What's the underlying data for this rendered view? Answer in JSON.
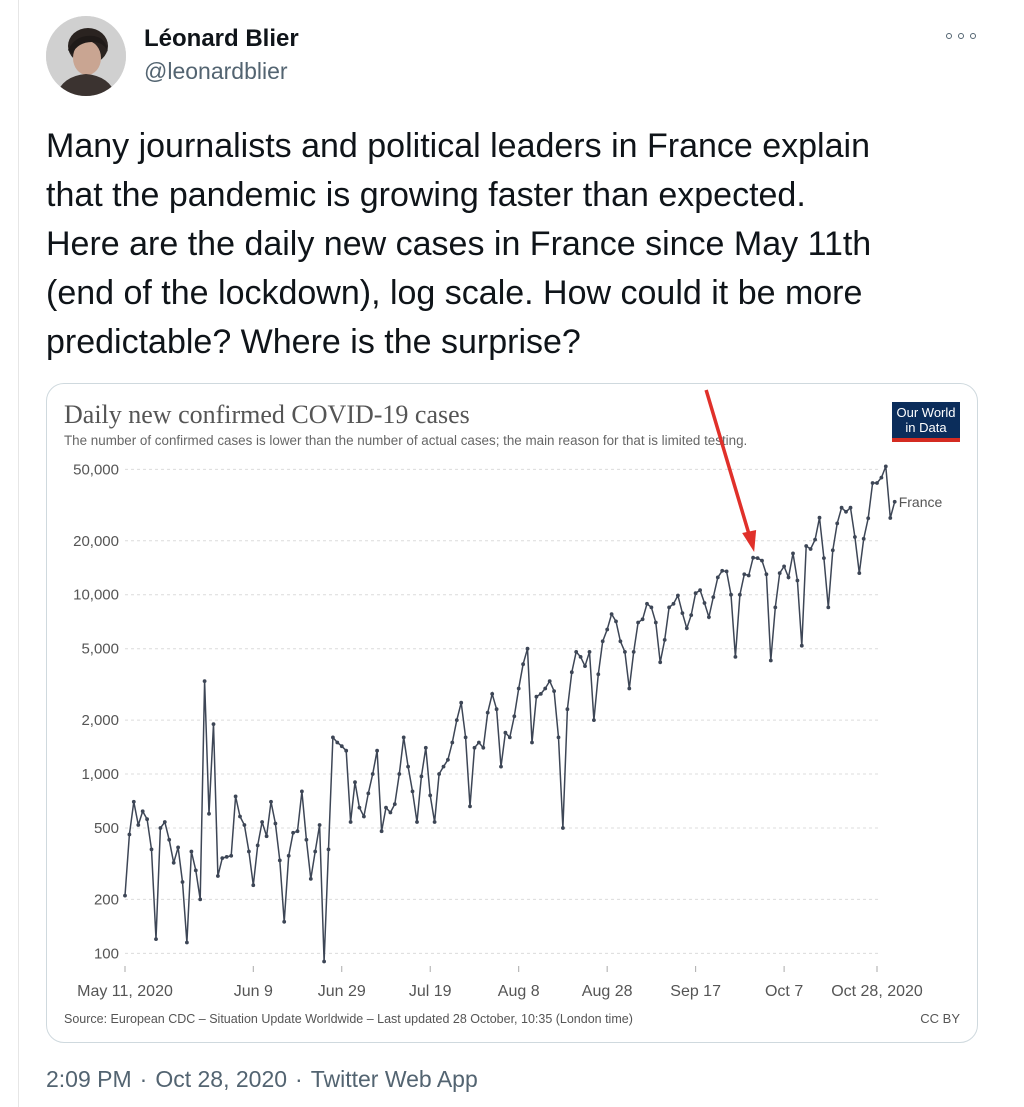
{
  "tweet": {
    "author_name": "Léonard Blier",
    "author_handle": "@leonardblier",
    "text": "Many journalists and political leaders in France explain\nthat the pandemic is growing faster than expected.\nHere are the daily new cases in France since May 11th\n(end of the lockdown), log scale. How could it be more\npredictable? Where is the surprise?",
    "time": "2:09 PM",
    "separator": "·",
    "date": "Oct 28, 2020",
    "source": "Twitter Web App",
    "more_icon": "more-horizontal-icon"
  },
  "chart_data": {
    "type": "line",
    "title": "Daily new confirmed COVID-19 cases",
    "subtitle": "The number of confirmed cases is lower than the number of actual cases; the main reason for that is limited testing.",
    "logo_line1": "Our World",
    "logo_line2": "in Data",
    "source": "Source: European CDC – Situation Update Worldwide – Last updated 28 October, 10:35 (London time)",
    "license": "CC BY",
    "y_scale": "log",
    "ylim": [
      85,
      55000
    ],
    "y_ticks": [
      100,
      200,
      500,
      1000,
      2000,
      5000,
      10000,
      20000,
      50000
    ],
    "y_tick_labels": [
      "100",
      "200",
      "500",
      "1,000",
      "2,000",
      "5,000",
      "10,000",
      "20,000",
      "50,000"
    ],
    "x_ticks": [
      "2020-05-11",
      "2020-06-09",
      "2020-06-29",
      "2020-07-19",
      "2020-08-08",
      "2020-08-28",
      "2020-09-17",
      "2020-10-07",
      "2020-10-28"
    ],
    "x_tick_labels": [
      "May 11, 2020",
      "Jun 9",
      "Jun 29",
      "Jul 19",
      "Aug 8",
      "Aug 28",
      "Sep 17",
      "Oct 7",
      "Oct 28, 2020"
    ],
    "grid": true,
    "line_color": "#3d4656",
    "arrow_color": "#e0302a",
    "series": [
      {
        "name": "France",
        "x_start": "2020-05-11",
        "step": "1 day",
        "values": [
          210,
          460,
          700,
          520,
          620,
          560,
          380,
          120,
          500,
          540,
          430,
          320,
          390,
          250,
          115,
          370,
          290,
          200,
          3300,
          600,
          1900,
          270,
          340,
          345,
          350,
          750,
          580,
          520,
          370,
          240,
          400,
          540,
          450,
          700,
          530,
          330,
          150,
          350,
          470,
          480,
          800,
          430,
          260,
          370,
          520,
          90,
          380,
          1600,
          1500,
          1430,
          1350,
          540,
          900,
          650,
          580,
          780,
          1000,
          1350,
          480,
          650,
          610,
          680,
          1000,
          1600,
          1100,
          800,
          540,
          970,
          1400,
          760,
          540,
          1000,
          1100,
          1200,
          1500,
          2000,
          2500,
          1600,
          660,
          1400,
          1500,
          1400,
          2200,
          2800,
          2300,
          1100,
          1700,
          1600,
          2100,
          3000,
          4100,
          5000,
          1500,
          2700,
          2800,
          3000,
          3300,
          2900,
          1600,
          500,
          2300,
          3700,
          4800,
          4500,
          4000,
          4800,
          2000,
          3600,
          5500,
          6400,
          7800,
          7100,
          5500,
          4800,
          3000,
          4800,
          7000,
          7300,
          8900,
          8500,
          7000,
          4200,
          5600,
          8500,
          8900,
          9900,
          7900,
          6500,
          7700,
          10200,
          10600,
          9000,
          7500,
          9700,
          12500,
          13600,
          13500,
          10000,
          4500,
          10000,
          13000,
          12800,
          16100,
          16000,
          15500,
          13000,
          4300,
          8500,
          13200,
          14400,
          12500,
          17000,
          12000,
          5200,
          18700,
          18000,
          20300,
          26900,
          16000,
          8500,
          17700,
          25000,
          30600,
          29000,
          30600,
          21000,
          13200,
          20500,
          26700,
          42000,
          42000,
          45000,
          52000,
          26800,
          33000
        ]
      }
    ],
    "series_label": "France",
    "annotation_arrow_target": "2020-09-30"
  }
}
